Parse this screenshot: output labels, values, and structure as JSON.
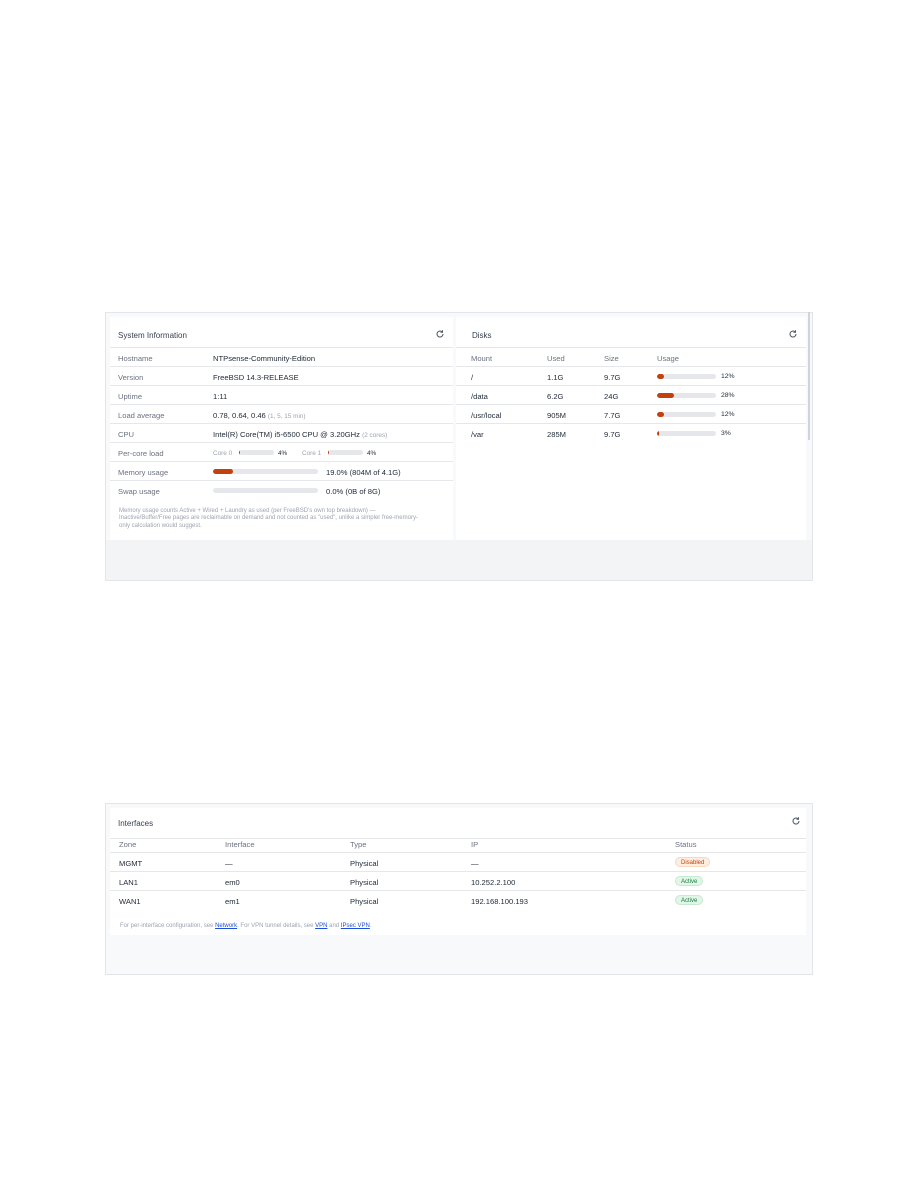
{
  "system_info": {
    "title": "System Information",
    "refresh_icon": "refresh-icon",
    "rows": {
      "hostname": {
        "label": "Hostname",
        "value": "NTPsense-Community-Edition"
      },
      "version": {
        "label": "Version",
        "value": "FreeBSD 14.3-RELEASE"
      },
      "uptime": {
        "label": "Uptime",
        "value": "1:11"
      },
      "load": {
        "label": "Load average",
        "value": "0.78, 0.64, 0.46",
        "hint": "(1, 5, 15 min)"
      },
      "cpu": {
        "label": "CPU",
        "value": "Intel(R) Core(TM) i5-6500 CPU @ 3.20GHz",
        "hint": "(2 cores)"
      },
      "per_core": {
        "label": "Per-core load",
        "cores": [
          {
            "name": "Core 0",
            "percent_text": "4%",
            "fraction": 0.04
          },
          {
            "name": "Core 1",
            "percent_text": "4%",
            "fraction": 0.04
          }
        ]
      },
      "memory": {
        "label": "Memory usage",
        "value": "19.0% (804M of 4.1G)",
        "fraction": 0.19
      },
      "swap": {
        "label": "Swap usage",
        "value": "0.0% (0B of 8G)",
        "fraction": 0.0
      }
    },
    "note_line1": "Memory usage counts Active + Wired + Laundry as used (per FreeBSD's own top breakdown) —",
    "note_line2": "Inactive/Buffer/Free pages are reclaimable on demand and not counted as \"used\", unlike a simpler free-memory-",
    "note_line3": "only calculation would suggest."
  },
  "disks": {
    "title": "Disks",
    "refresh_icon": "refresh-icon",
    "headers": {
      "mount": "Mount",
      "used": "Used",
      "size": "Size",
      "usage": "Usage"
    },
    "rows": [
      {
        "mount": "/",
        "used": "1.1G",
        "size": "9.7G",
        "percent_text": "12%",
        "fraction": 0.12
      },
      {
        "mount": "/data",
        "used": "6.2G",
        "size": "24G",
        "percent_text": "28%",
        "fraction": 0.28
      },
      {
        "mount": "/usr/local",
        "used": "905M",
        "size": "7.7G",
        "percent_text": "12%",
        "fraction": 0.12
      },
      {
        "mount": "/var",
        "used": "285M",
        "size": "9.7G",
        "percent_text": "3%",
        "fraction": 0.03
      }
    ]
  },
  "interfaces": {
    "title": "Interfaces",
    "refresh_icon": "refresh-icon",
    "headers": {
      "zone": "Zone",
      "interface": "Interface",
      "type": "Type",
      "ip": "IP",
      "status": "Status"
    },
    "rows": [
      {
        "zone": "MGMT",
        "interface": "—",
        "type": "Physical",
        "ip": "—",
        "status": "Disabled"
      },
      {
        "zone": "LAN1",
        "interface": "em0",
        "type": "Physical",
        "ip": "10.252.2.100",
        "status": "Active"
      },
      {
        "zone": "WAN1",
        "interface": "em1",
        "type": "Physical",
        "ip": "192.168.100.193",
        "status": "Active"
      }
    ],
    "footer": {
      "prefix": "For per-interface configuration, see ",
      "link_network": "Network",
      "middle": ". For VPN tunnel details, see ",
      "link_vpn": "VPN",
      "and": " and ",
      "link_ipsec": "IPsec VPN",
      "suffix": "."
    }
  },
  "colors": {
    "bar_fill": "#c2410c",
    "bar_track": "#e5e7eb",
    "badge_disabled": "#c2410c",
    "badge_active": "#15803d"
  }
}
